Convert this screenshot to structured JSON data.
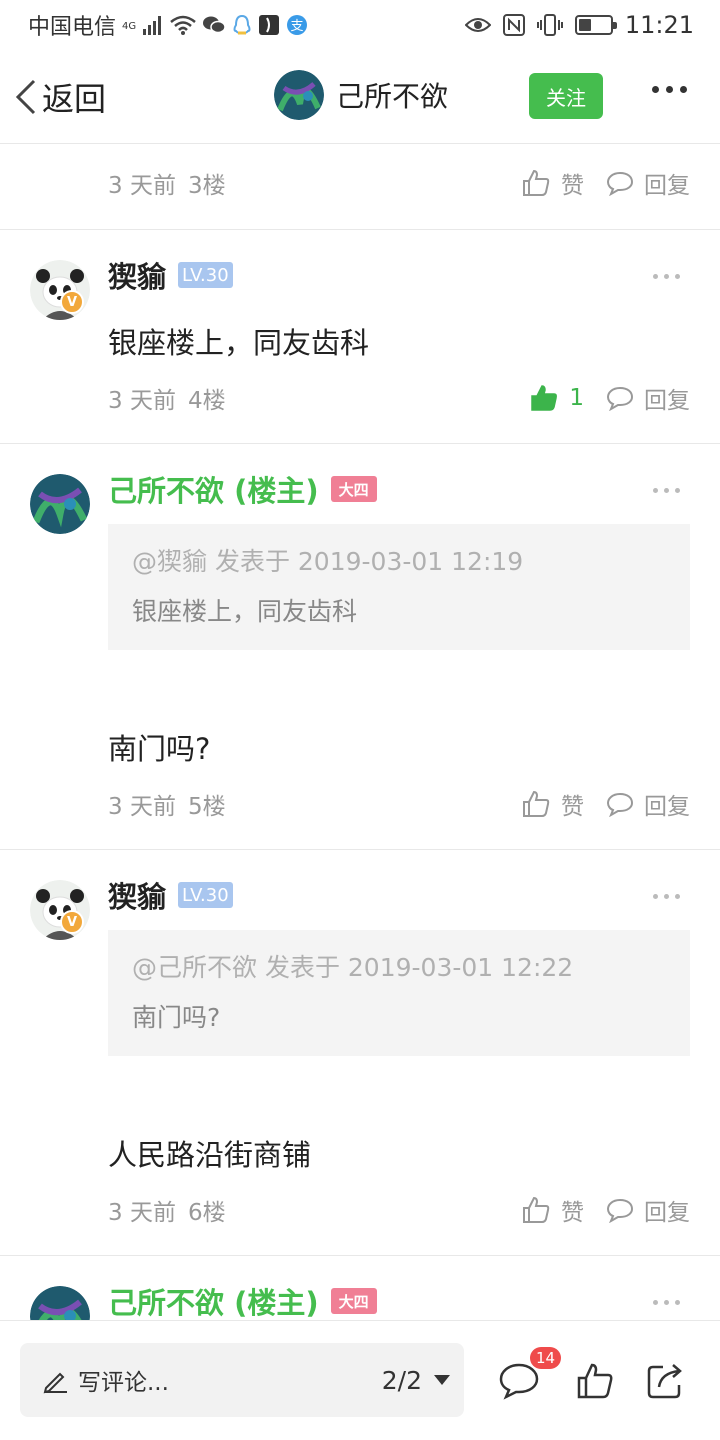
{
  "status_bar": {
    "carrier": "中国电信",
    "network": "4G",
    "time": "11:21",
    "battery_level": 0.4
  },
  "nav": {
    "back_label": "返回",
    "title": "己所不欲",
    "follow_label": "关注"
  },
  "actions": {
    "like_label": "赞",
    "reply_label": "回复"
  },
  "posts": [
    {
      "time": "3 天前",
      "floor": "3楼"
    },
    {
      "user": "猰貐",
      "level": "LV.30",
      "content": "银座楼上，同友齿科",
      "time": "3 天前",
      "floor": "4楼",
      "likes": "1"
    },
    {
      "user": "己所不欲 (楼主)",
      "grade": "大四",
      "quote_head": "@猰貐 发表于 2019-03-01 12:19",
      "quote_body": "银座楼上，同友齿科",
      "content": "南门吗?",
      "time": "3 天前",
      "floor": "5楼"
    },
    {
      "user": "猰貐",
      "level": "LV.30",
      "quote_head": "@己所不欲 发表于 2019-03-01 12:22",
      "quote_body": "南门吗?",
      "content": "人民路沿街商铺",
      "time": "3 天前",
      "floor": "6楼"
    },
    {
      "user": "己所不欲 (楼主)",
      "grade": "大四"
    }
  ],
  "bottom_bar": {
    "comment_placeholder": "写评论...",
    "page_indicator": "2/2",
    "comment_count": "14"
  },
  "colors": {
    "accent_green": "#45bd4e",
    "level_badge": "#a9c6ef",
    "grade_badge": "#f07f95",
    "notification_badge": "#ef4b4b"
  }
}
